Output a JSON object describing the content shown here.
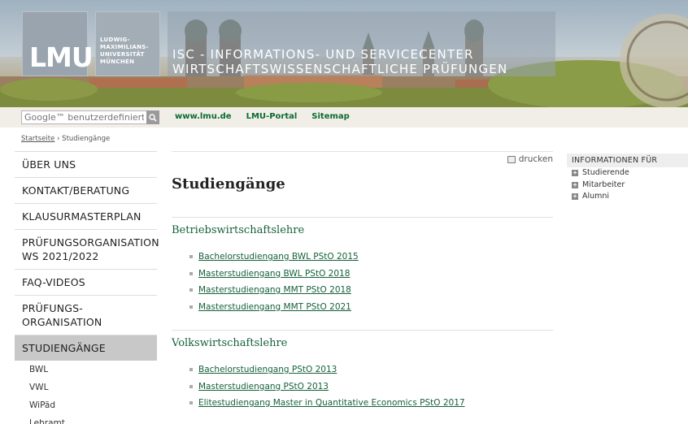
{
  "header": {
    "logo_text": "LMU",
    "university_lines": [
      "LUDWIG-",
      "MAXIMILIANS-",
      "UNIVERSITÄT",
      "MÜNCHEN"
    ],
    "title_line1": "ISC - INFORMATIONS- UND SERVICECENTER",
    "title_line2": "WIRTSCHAFTSWISSENSCHAFTLICHE PRÜFUNGEN"
  },
  "toolbar": {
    "search_placeholder": "Google™ benutzerdefinierte",
    "links": [
      "www.lmu.de",
      "LMU-Portal",
      "Sitemap"
    ]
  },
  "breadcrumb": {
    "home": "Startseite",
    "separator": "›",
    "current": "Studiengänge"
  },
  "sidebar": {
    "items": [
      {
        "label": "ÜBER UNS"
      },
      {
        "label": "KONTAKT/BERATUNG"
      },
      {
        "label": "KLAUSURMASTERPLAN"
      },
      {
        "label": "PRÜFUNGSORGANISATION WS 2021/2022"
      },
      {
        "label": "FAQ-VIDEOS"
      },
      {
        "label": "PRÜFUNGS-ORGANISATION"
      },
      {
        "label": "STUDIENGÄNGE"
      }
    ],
    "subitems": [
      "BWL",
      "VWL",
      "WiPäd",
      "Lehramt"
    ]
  },
  "main": {
    "print_label": "drucken",
    "title": "Studiengänge",
    "sections": [
      {
        "heading": "Betriebswirtschaftslehre",
        "links": [
          "Bachelorstudiengang BWL PStO 2015",
          "Masterstudiengang BWL PStO 2018",
          "Masterstudiengang MMT PStO 2018",
          "Masterstudiengang MMT PStO 2021"
        ]
      },
      {
        "heading": "Volkswirtschaftslehre",
        "links": [
          "Bachelorstudiengang PStO 2013",
          "Masterstudiengang PStO 2013",
          "Elitestudiengang Master in Quantitative Economics PStO 2017"
        ]
      }
    ]
  },
  "info": {
    "heading": "INFORMATIONEN FÜR",
    "items": [
      "Studierende",
      "Mitarbeiter",
      "Alumni"
    ]
  },
  "colors": {
    "link_green": "#16613a",
    "toolbar_green": "#0a6b33",
    "active_nav_bg": "#c8c8c8"
  }
}
